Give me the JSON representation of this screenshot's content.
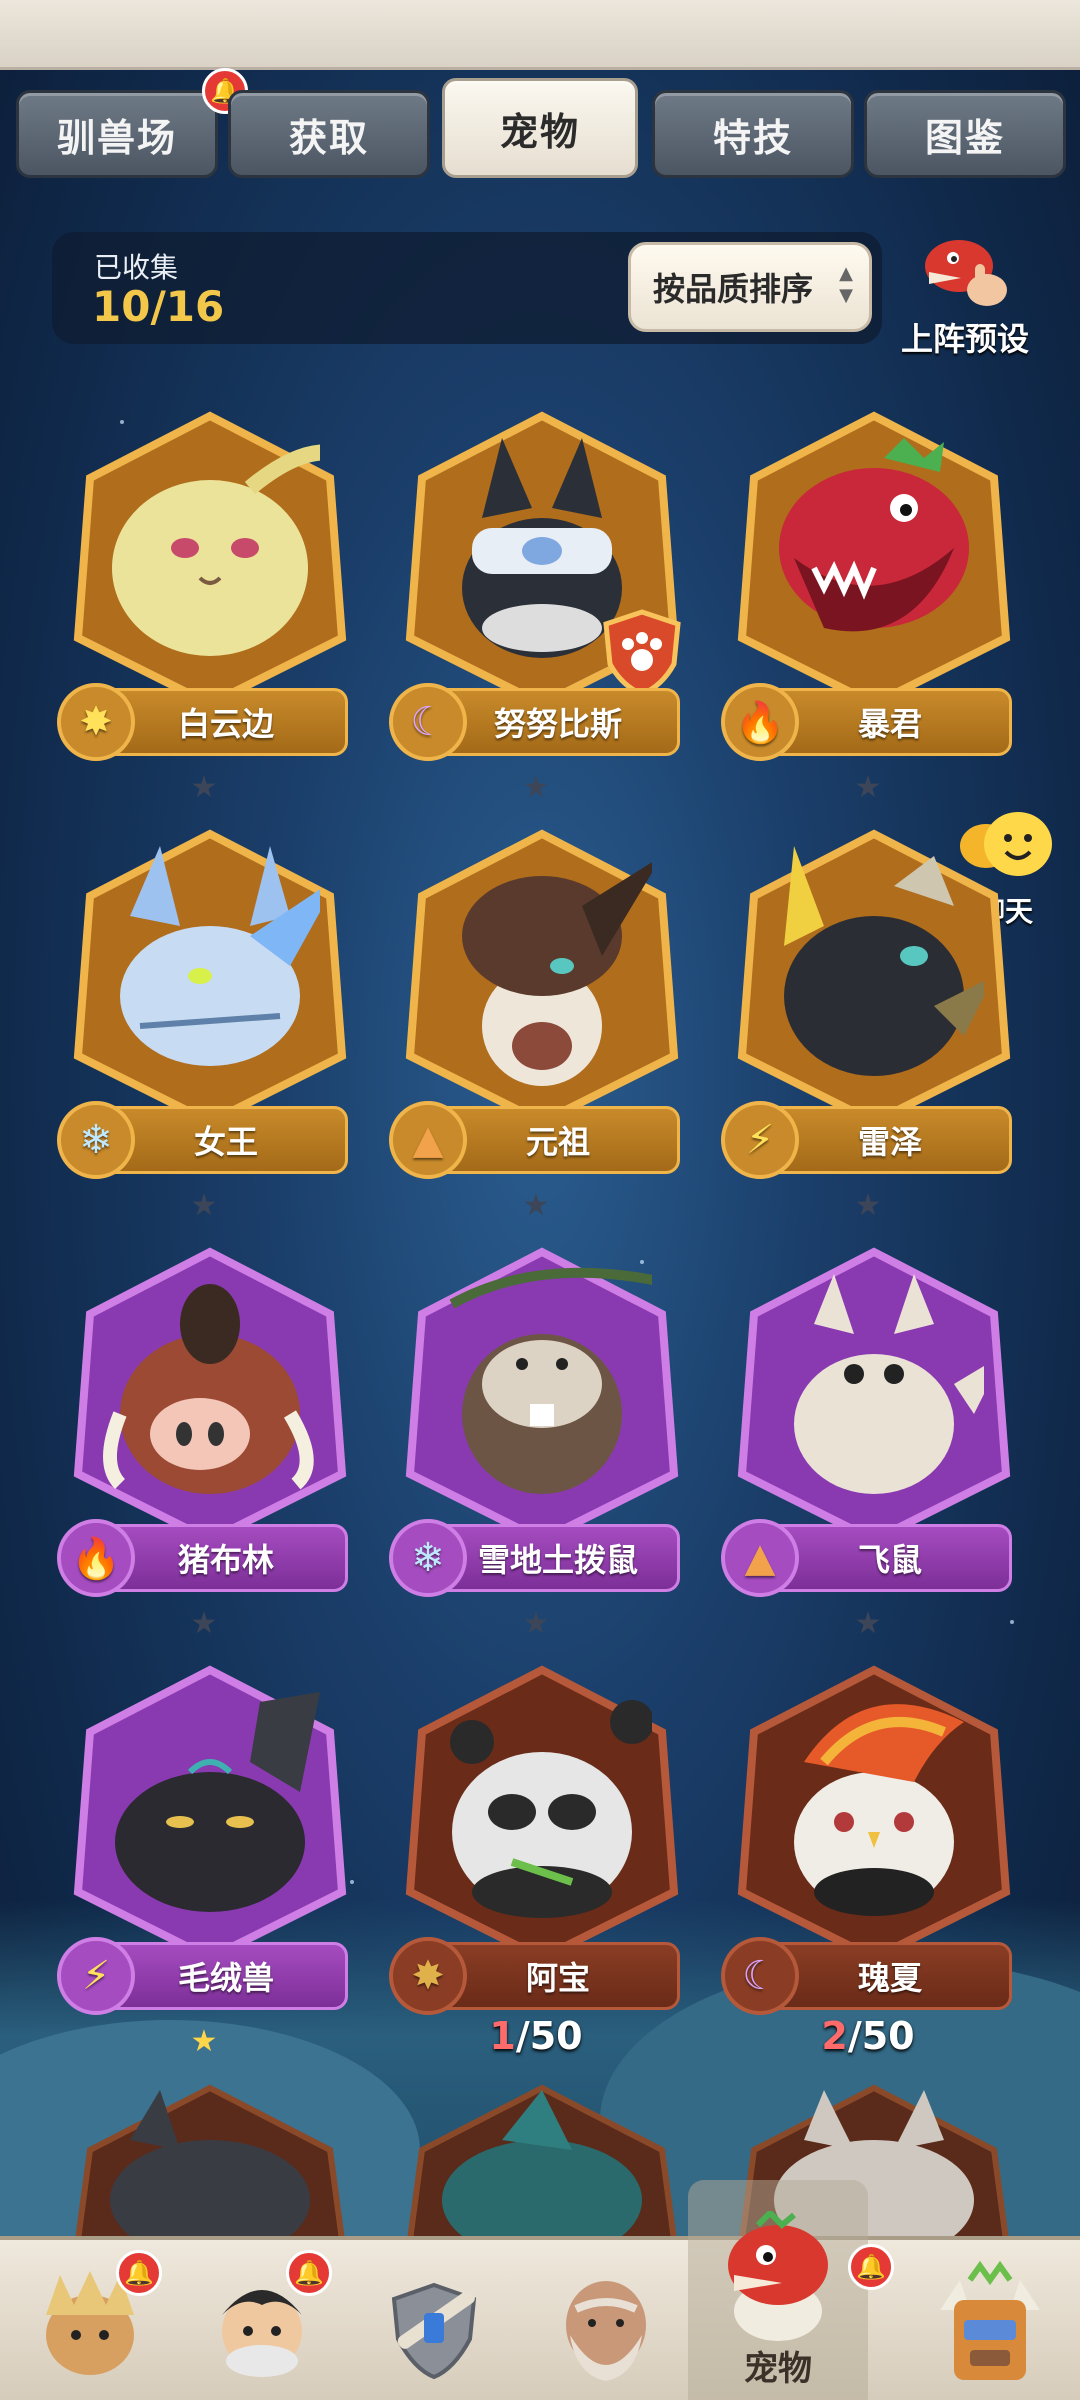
{
  "tabs": [
    {
      "label": "驯兽场",
      "notification": true
    },
    {
      "label": "获取",
      "notification": false
    },
    {
      "label": "宠物",
      "active": true
    },
    {
      "label": "特技",
      "notification": false
    },
    {
      "label": "图鉴",
      "notification": false
    }
  ],
  "collection": {
    "label": "已收集",
    "count": "10/16"
  },
  "sort_button": {
    "label": "按品质排序"
  },
  "preset": {
    "label": "上阵预设"
  },
  "chat": {
    "label": "聊天"
  },
  "pets": [
    {
      "name": "白云边",
      "element": "sun",
      "frame": "gold",
      "stars": "★",
      "star_filled": false
    },
    {
      "name": "努努比斯",
      "element": "moon",
      "frame": "gold",
      "stars": "★",
      "star_filled": false,
      "badge": "paw-shield-icon"
    },
    {
      "name": "暴君",
      "element": "fire",
      "frame": "gold",
      "stars": "★",
      "star_filled": false
    },
    {
      "name": "女王",
      "element": "ice",
      "frame": "gold",
      "stars": "★",
      "star_filled": false
    },
    {
      "name": "元祖",
      "element": "earth",
      "frame": "gold",
      "stars": "★",
      "star_filled": false
    },
    {
      "name": "雷泽",
      "element": "thunder",
      "frame": "gold",
      "stars": "★",
      "star_filled": false
    },
    {
      "name": "猪布林",
      "element": "fire",
      "frame": "purple",
      "stars": "★",
      "star_filled": false
    },
    {
      "name": "雪地土拨鼠",
      "element": "ice",
      "frame": "purple",
      "stars": "★",
      "star_filled": false
    },
    {
      "name": "飞鼠",
      "element": "earth",
      "frame": "purple",
      "stars": "★",
      "star_filled": false
    },
    {
      "name": "毛绒兽",
      "element": "thunder",
      "frame": "purple",
      "stars": "★",
      "star_filled": true
    },
    {
      "name": "阿宝",
      "element": "sun",
      "frame": "brown",
      "progress_current": "1",
      "progress_total": "/50"
    },
    {
      "name": "瑰夏",
      "element": "moon",
      "frame": "brown",
      "progress_current": "2",
      "progress_total": "/50"
    }
  ],
  "bottom_nav": [
    {
      "icon": "caveman-avatar-icon",
      "notification": true
    },
    {
      "icon": "trainer-avatar-icon",
      "notification": true
    },
    {
      "icon": "sword-shield-icon",
      "notification": false
    },
    {
      "icon": "elder-avatar-icon",
      "notification": false
    },
    {
      "icon": "red-dino-pet-icon",
      "label": "宠物",
      "active": true,
      "notification": true
    },
    {
      "icon": "tribal-totem-icon",
      "notification": false
    }
  ],
  "colors": {
    "gold_frame": "#f0b54a",
    "purple_frame": "#cf7ee6",
    "brown_frame": "#b5593a",
    "accent_count": "#f3c84a",
    "notification": "#e53935"
  }
}
